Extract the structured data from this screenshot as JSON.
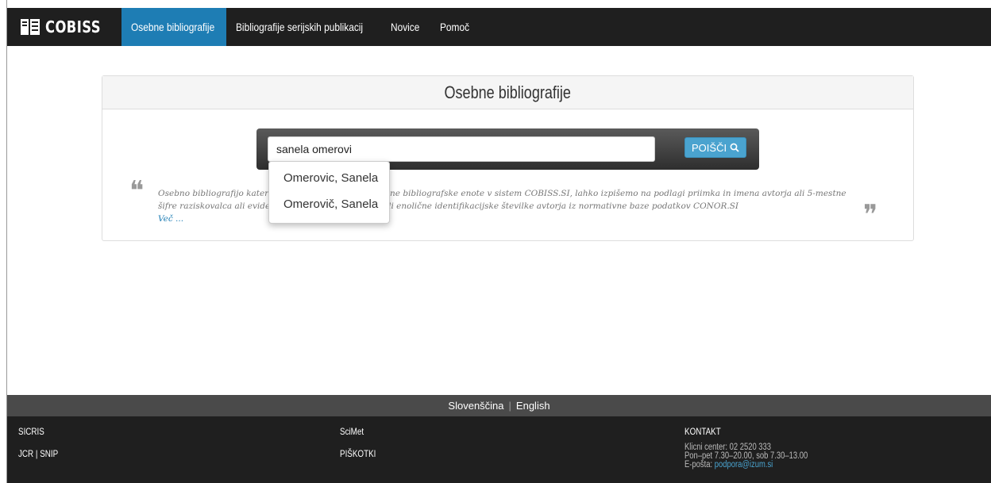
{
  "brand": {
    "name": "COBISS",
    "logo_icon": "cobiss-logo-icon"
  },
  "nav": {
    "items": [
      {
        "label": "Osebne bibliografije",
        "active": true
      },
      {
        "label": "Bibliografije serijskih publikacij",
        "active": false
      },
      {
        "label": "Novice",
        "active": false
      },
      {
        "label": "Pomoč",
        "active": false
      }
    ]
  },
  "panel": {
    "title": "Osebne bibliografije"
  },
  "search": {
    "value": "sanela omerovi",
    "button_label": "POIŠČI",
    "button_icon": "search-icon"
  },
  "suggestions": [
    "Omerovic, Sanela",
    "Omerovič, Sanela"
  ],
  "description": {
    "text": "Osebno bibliografijo katerega koli avtorja, ki ima vpisane bibliografske enote v sistem COBISS.SI, lahko izpišemo na podlagi priimka in imena avtorja ali 5-mestne šifre raziskovalca ali evidenčne številke raziskovalca ali enolične identifikacijske številke avtorja iz normativne baze podatkov CONOR.SI",
    "more_label": "Več ...",
    "quote_open": "❝",
    "quote_close": "❞"
  },
  "languages": {
    "current": "Slovenščina",
    "other": "English",
    "separator": "|"
  },
  "footer": {
    "col1": {
      "line1": "SICRIS",
      "line2a": "JCR",
      "sep": "|",
      "line2b": "SNIP"
    },
    "col2": {
      "line1": "SciMet",
      "line2": "PIŠKOTKI"
    },
    "contact": {
      "title": "KONTAKT",
      "phone": "Klicni center: 02 2520 333",
      "hours": "Pon–pet 7.30–20.00, sob 7.30–13.00",
      "email_label": "E-pošta:",
      "email": "podpora@izum.si"
    }
  },
  "colors": {
    "accent": "#1e7db4",
    "nav_bg": "#1f1f1f",
    "button": "#4aa3cf"
  }
}
